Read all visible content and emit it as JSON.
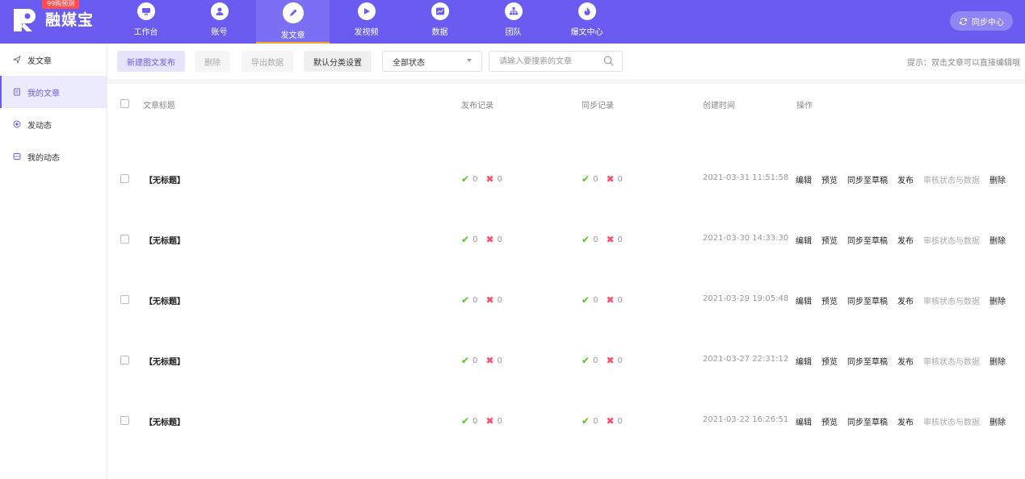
{
  "header": {
    "logo_text": "融媒宝",
    "logo_badge": "99购预测",
    "nav": [
      {
        "label": "工作台",
        "icon": "monitor-icon"
      },
      {
        "label": "账号",
        "icon": "user-icon"
      },
      {
        "label": "发文章",
        "icon": "pen-icon",
        "active": true
      },
      {
        "label": "发视频",
        "icon": "video-icon"
      },
      {
        "label": "数据",
        "icon": "chart-icon"
      },
      {
        "label": "团队",
        "icon": "team-icon"
      },
      {
        "label": "爆文中心",
        "icon": "fire-icon"
      }
    ],
    "sync_center": "同步中心"
  },
  "sidebar": {
    "items": [
      {
        "label": "发文章",
        "icon": "send-icon"
      },
      {
        "label": "我的文章",
        "icon": "document-icon",
        "active": true
      },
      {
        "label": "发动态",
        "icon": "target-icon"
      },
      {
        "label": "我的动态",
        "icon": "message-icon"
      }
    ]
  },
  "toolbar": {
    "new_post": "新建图文发布",
    "delete": "删除",
    "export": "导出数据",
    "category_settings": "默认分类设置",
    "status_select": "全部状态",
    "search_placeholder": "请输入要搜索的文章",
    "hint": "提示：双击文章可以直接编辑哦"
  },
  "table": {
    "columns": {
      "title": "文章标题",
      "publish": "发布记录",
      "sync": "同步记录",
      "created": "创建时间",
      "actions": "操作"
    },
    "actions": [
      "编辑",
      "预览",
      "同步至草稿",
      "发布",
      "审核状态与数据",
      "删除"
    ],
    "rows": [
      {
        "title": "【无标题】",
        "pub_ok": "0",
        "pub_fail": "0",
        "sync_ok": "0",
        "sync_fail": "0",
        "created": "2021-03-31 11:51:58"
      },
      {
        "title": "【无标题】",
        "pub_ok": "0",
        "pub_fail": "0",
        "sync_ok": "0",
        "sync_fail": "0",
        "created": "2021-03-30 14:33:30"
      },
      {
        "title": "【无标题】",
        "pub_ok": "0",
        "pub_fail": "0",
        "sync_ok": "0",
        "sync_fail": "0",
        "created": "2021-03-29 19:05:48"
      },
      {
        "title": "【无标题】",
        "pub_ok": "0",
        "pub_fail": "0",
        "sync_ok": "0",
        "sync_fail": "0",
        "created": "2021-03-27 22:31:12"
      },
      {
        "title": "【无标题】",
        "pub_ok": "0",
        "pub_fail": "0",
        "sync_ok": "0",
        "sync_fail": "0",
        "created": "2021-03-22 16:26:51"
      }
    ]
  },
  "colors": {
    "brand": "#6a5cf0",
    "ok": "#52c41a",
    "fail": "#ff4d6d"
  }
}
